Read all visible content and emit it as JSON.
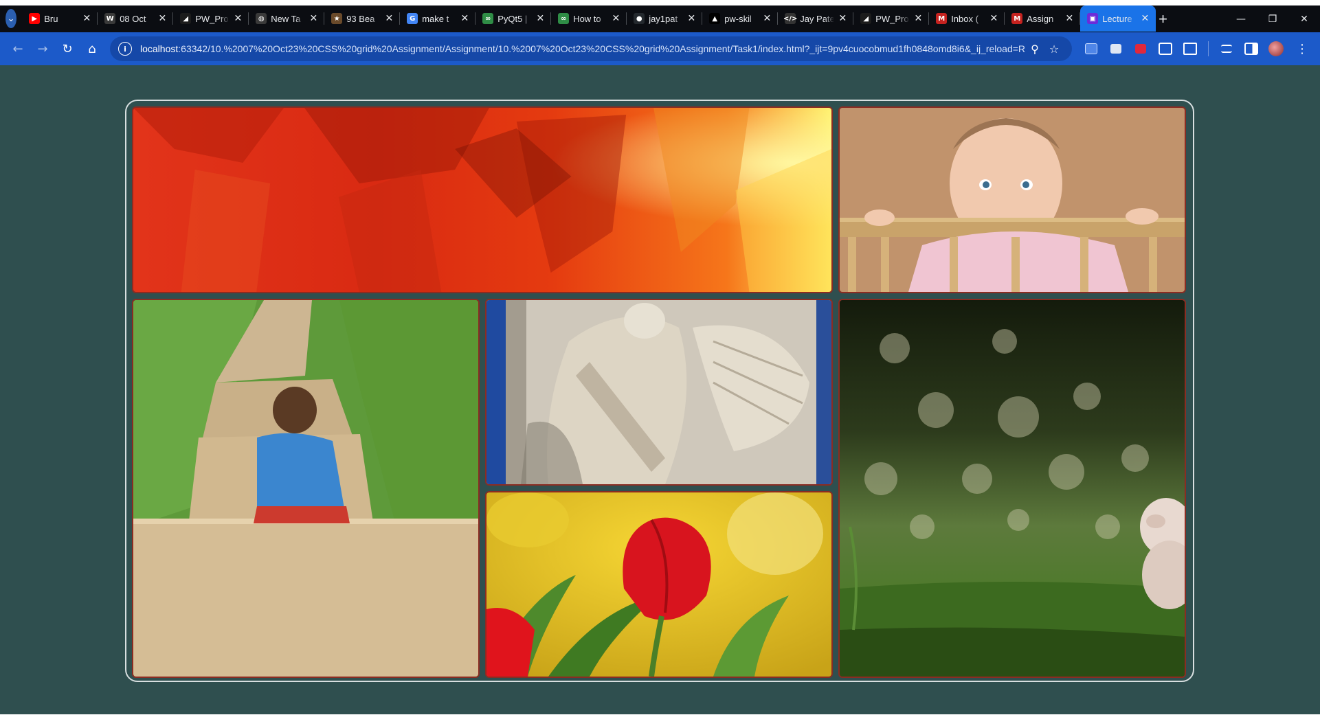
{
  "browser": {
    "tabs": [
      {
        "title": "Bru",
        "favicon": "youtube-icon",
        "color": "#ff0000",
        "glyph": "▶",
        "active": false
      },
      {
        "title": "08 Oct",
        "favicon": "wordpress-icon",
        "color": "#3a3a3a",
        "glyph": "W",
        "active": false
      },
      {
        "title": "PW_Pro",
        "favicon": "pw-icon",
        "color": "#1c1c1c",
        "glyph": "◢",
        "active": false
      },
      {
        "title": "New Ta",
        "favicon": "globe-icon",
        "color": "#3a3a3a",
        "glyph": "◍",
        "active": false
      },
      {
        "title": "93 Bea",
        "favicon": "bookmark-icon",
        "color": "#6a4a2a",
        "glyph": "★",
        "active": false
      },
      {
        "title": "make t",
        "favicon": "google-icon",
        "color": "#4285f4",
        "glyph": "G",
        "active": false
      },
      {
        "title": "PyQt5 |",
        "favicon": "gfg-icon",
        "color": "#2f8d46",
        "glyph": "∞",
        "active": false
      },
      {
        "title": "How to",
        "favicon": "gfg-icon",
        "color": "#2f8d46",
        "glyph": "∞",
        "active": false
      },
      {
        "title": "jay1pat",
        "favicon": "github-icon",
        "color": "#24292e",
        "glyph": "●",
        "active": false
      },
      {
        "title": "pw-skil",
        "favicon": "vercel-icon",
        "color": "#000000",
        "glyph": "▲",
        "active": false
      },
      {
        "title": "Jay Pate",
        "favicon": "code-icon",
        "color": "#333333",
        "glyph": "</>",
        "active": false
      },
      {
        "title": "PW_Pro",
        "favicon": "pw-icon",
        "color": "#1c1c1c",
        "glyph": "◢",
        "active": false
      },
      {
        "title": "Inbox (",
        "favicon": "gmail-icon",
        "color": "#c5221f",
        "glyph": "M",
        "active": false
      },
      {
        "title": "Assign",
        "favicon": "gmail-icon",
        "color": "#c5221f",
        "glyph": "M",
        "active": false
      },
      {
        "title": "Lecture",
        "favicon": "lecture-icon",
        "color": "#6c2bd9",
        "glyph": "▣",
        "active": true
      }
    ],
    "tab_close_glyph": "✕",
    "new_tab_glyph": "+",
    "window": {
      "minimize": "—",
      "restore": "❐",
      "close": "✕"
    },
    "url_host": "localhost",
    "url_rest": ":63342/10.%2007%20Oct23%20CSS%20grid%20Assignment/Assignment/10.%2007%20Oct23%20CSS%20grid%20Assignment/Task1/index.html?_ijt=9pv4cuocobmud1fh0848omd8i6&_ij_reload=RELO..."
  },
  "gallery": {
    "images": [
      {
        "name": "orange-crystal-image"
      },
      {
        "name": "baby-crib-image"
      },
      {
        "name": "boy-on-steps-image"
      },
      {
        "name": "angel-statue-image"
      },
      {
        "name": "red-tulip-image"
      },
      {
        "name": "cherub-grass-image"
      }
    ],
    "colors": {
      "page_bg": "#2f4f4f",
      "cell_border": "#8b2c22",
      "frame_border": "#d8dfe0"
    }
  }
}
